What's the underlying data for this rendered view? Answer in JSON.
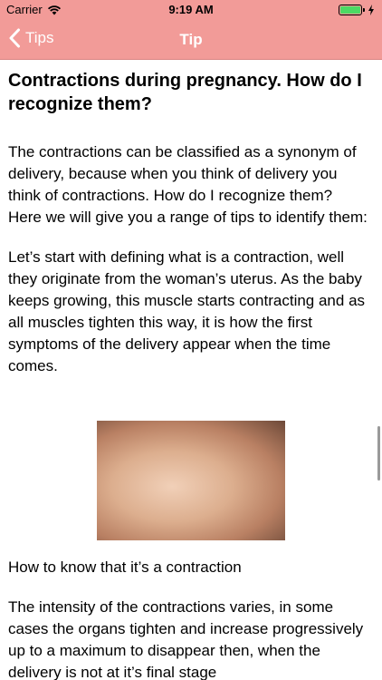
{
  "status": {
    "carrier": "Carrier",
    "time": "9:19 AM"
  },
  "nav": {
    "back_label": "Tips",
    "title": "Tip"
  },
  "article": {
    "title": "Contractions during pregnancy. How do I recognize them?",
    "paragraphs": [
      "The contractions can be classified as a synonym of delivery, because when you think of delivery you think of contractions. How do I recognize them? Here we will give you a range of tips to identify them:",
      "Let’s start with defining what is a contraction, well they originate from the woman’s uterus. As the baby keeps growing, this muscle starts contracting and as all muscles tighten this way, it is how the first symptoms of the delivery appear when the time comes."
    ],
    "subheading": "How to know that it’s a contraction",
    "paragraph_after": "The intensity of the contractions varies, in some cases the organs tighten and increase progressively up to a maximum to disappear then, when the delivery is not at it’s final stage"
  },
  "colors": {
    "nav_background": "#f29b98",
    "nav_text": "#ffffff",
    "battery": "#4cd964"
  },
  "icons": {
    "wifi": "wifi-icon",
    "battery": "battery-icon",
    "back": "chevron-left-icon"
  }
}
